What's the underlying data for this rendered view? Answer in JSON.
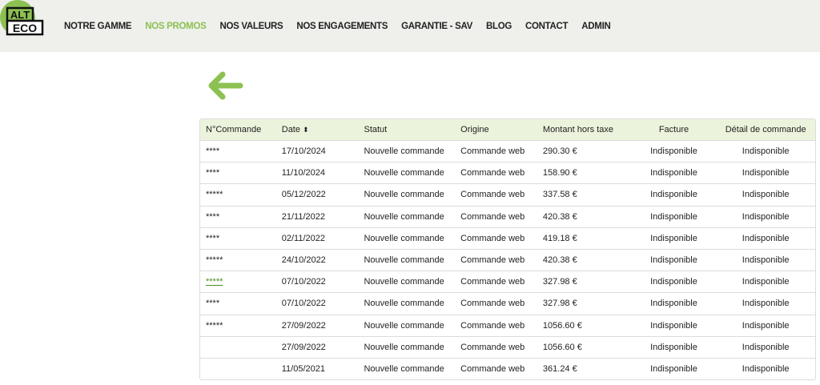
{
  "header": {
    "logo": {
      "line1": "ALT",
      "line2": "ECO"
    },
    "nav": [
      {
        "label": "NOTRE GAMME",
        "active": false
      },
      {
        "label": "NOS PROMOS",
        "active": true
      },
      {
        "label": "NOS VALEURS",
        "active": false
      },
      {
        "label": "NOS ENGAGEMENTS",
        "active": false
      },
      {
        "label": "GARANTIE - SAV",
        "active": false
      },
      {
        "label": "BLOG",
        "active": false
      },
      {
        "label": "CONTACT",
        "active": false
      },
      {
        "label": "ADMIN",
        "active": false
      }
    ]
  },
  "back_icon": "arrow-left-icon",
  "colors": {
    "accent": "#8cc152",
    "header_bg": "#efefec",
    "table_head_bg": "#ecf3dc"
  },
  "orders": {
    "columns": [
      "N°Commande",
      "Date",
      "Statut",
      "Origine",
      "Montant hors taxe",
      "Facture",
      "Détail de commande"
    ],
    "sort_icon": "⬍",
    "rows": [
      {
        "num": "****",
        "date": "17/10/2024",
        "status": "Nouvelle commande",
        "origin": "Commande web",
        "amount": "290.30 €",
        "invoice": "Indisponible",
        "detail": "Indisponible"
      },
      {
        "num": "****",
        "date": "11/10/2024",
        "status": "Nouvelle commande",
        "origin": "Commande web",
        "amount": "158.90 €",
        "invoice": "Indisponible",
        "detail": "Indisponible"
      },
      {
        "num": "*****",
        "date": "05/12/2022",
        "status": "Nouvelle commande",
        "origin": "Commande web",
        "amount": "337.58 €",
        "invoice": "Indisponible",
        "detail": "Indisponible"
      },
      {
        "num": "****",
        "date": "21/11/2022",
        "status": "Nouvelle commande",
        "origin": "Commande web",
        "amount": "420.38 €",
        "invoice": "Indisponible",
        "detail": "Indisponible"
      },
      {
        "num": "****",
        "date": "02/11/2022",
        "status": "Nouvelle commande",
        "origin": "Commande web",
        "amount": "419.18 €",
        "invoice": "Indisponible",
        "detail": "Indisponible"
      },
      {
        "num": "*****",
        "date": "24/10/2022",
        "status": "Nouvelle commande",
        "origin": "Commande web",
        "amount": "420.38 €",
        "invoice": "Indisponible",
        "detail": "Indisponible"
      },
      {
        "num": "*****",
        "link": true,
        "date": "07/10/2022",
        "status": "Nouvelle commande",
        "origin": "Commande web",
        "amount": "327.98 €",
        "invoice": "Indisponible",
        "detail": "Indisponible"
      },
      {
        "num": "****",
        "date": "07/10/2022",
        "status": "Nouvelle commande",
        "origin": "Commande web",
        "amount": "327.98 €",
        "invoice": "Indisponible",
        "detail": "Indisponible"
      },
      {
        "num": "*****",
        "date": "27/09/2022",
        "status": "Nouvelle commande",
        "origin": "Commande web",
        "amount": "1056.60 €",
        "invoice": "Indisponible",
        "detail": "Indisponible"
      },
      {
        "num": "",
        "date": "27/09/2022",
        "status": "Nouvelle commande",
        "origin": "Commande web",
        "amount": "1056.60 €",
        "invoice": "Indisponible",
        "detail": "Indisponible"
      },
      {
        "num": "",
        "date": "11/05/2021",
        "status": "Nouvelle commande",
        "origin": "Commande web",
        "amount": "361.24 €",
        "invoice": "Indisponible",
        "detail": "Indisponible"
      }
    ]
  }
}
